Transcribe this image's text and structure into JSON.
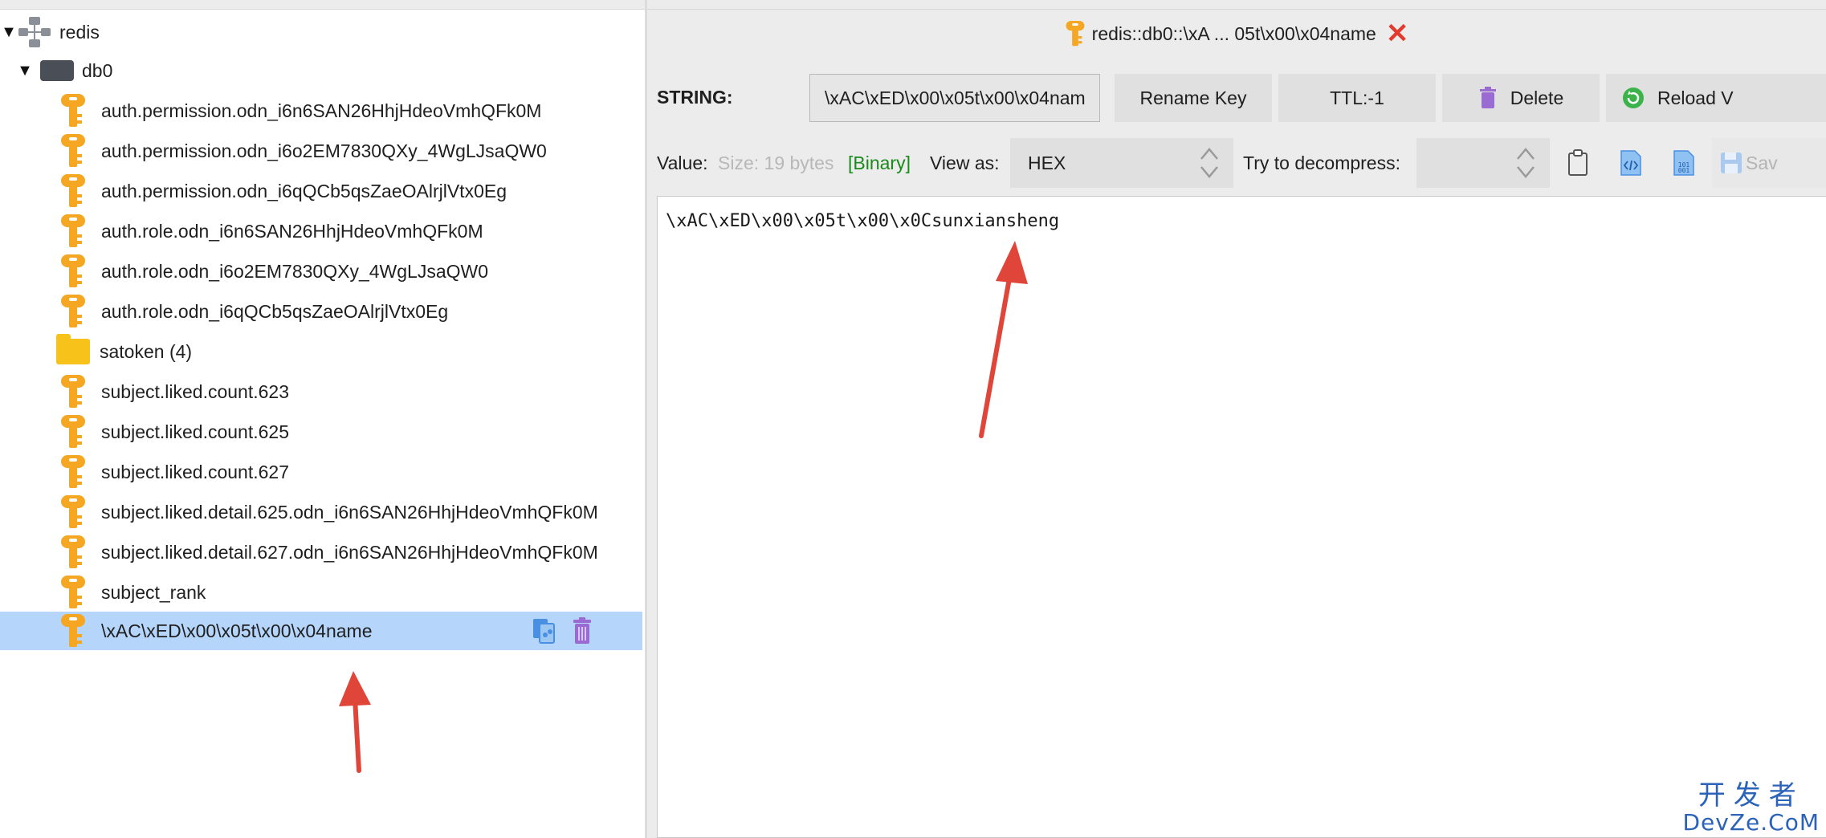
{
  "tree": {
    "server": "redis",
    "db": "db0",
    "folder": {
      "label": "satoken (4)"
    },
    "keys_before_folder": [
      "auth.permission.odn_i6n6SAN26HhjHdeoVmhQFk0M",
      "auth.permission.odn_i6o2EM7830QXy_4WgLJsaQW0",
      "auth.permission.odn_i6qQCb5qsZaeOAlrjlVtx0Eg",
      "auth.role.odn_i6n6SAN26HhjHdeoVmhQFk0M",
      "auth.role.odn_i6o2EM7830QXy_4WgLJsaQW0",
      "auth.role.odn_i6qQCb5qsZaeOAlrjlVtx0Eg"
    ],
    "keys_after_folder": [
      "subject.liked.count.623",
      "subject.liked.count.625",
      "subject.liked.count.627",
      "subject.liked.detail.625.odn_i6n6SAN26HhjHdeoVmhQFk0M",
      "subject.liked.detail.627.odn_i6n6SAN26HhjHdeoVmhQFk0M",
      "subject_rank"
    ],
    "selected_key": "\\xAC\\xED\\x00\\x05t\\x00\\x04name"
  },
  "tab": {
    "title": "redis::db0::\\xA ... 05t\\x00\\x04name",
    "close_icon": "close-icon"
  },
  "toolbar": {
    "type_label": "STRING:",
    "key_name": "\\xAC\\xED\\x00\\x05t\\x00\\x04name",
    "rename_label": "Rename Key",
    "ttl_label": "TTL:-1",
    "delete_label": "Delete",
    "reload_label": "Reload V"
  },
  "value_bar": {
    "value_label": "Value:",
    "size_label": "Size: 19 bytes",
    "binary_label": "[Binary]",
    "view_as_label": "View as:",
    "view_as_value": "HEX",
    "decompress_label": "Try to decompress:",
    "decompress_value": "",
    "save_label": "Sav"
  },
  "editor": {
    "content": "\\xAC\\xED\\x00\\x05t\\x00\\x0Csunxiansheng"
  },
  "watermark": {
    "cn": "开发者",
    "en": "DevZe.CoM"
  },
  "colors": {
    "selection": "#b5d5fb",
    "key_icon": "#f5a623",
    "binary": "#1a8a1a",
    "close": "#e23b2e",
    "arrow": "#e0453a",
    "watermark": "#2b63b8"
  }
}
